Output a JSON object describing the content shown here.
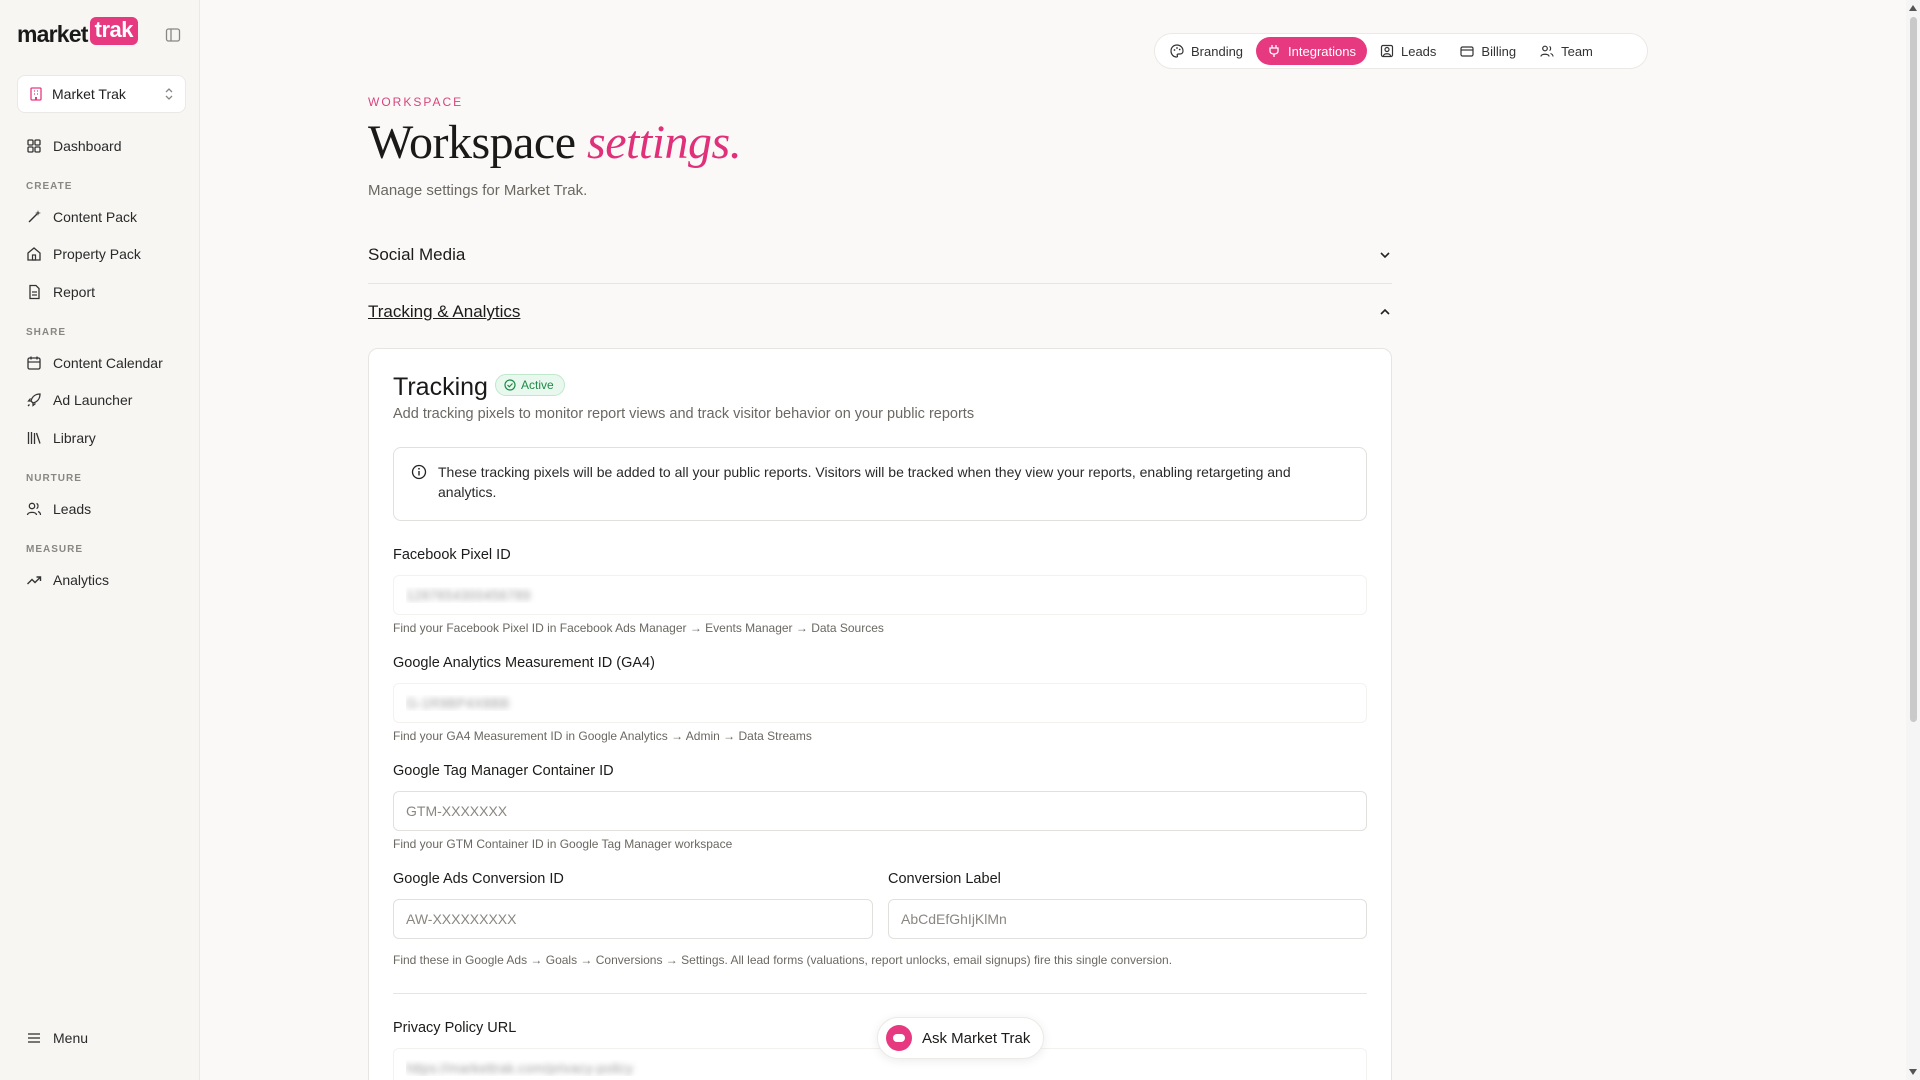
{
  "brand": {
    "logo_part1": "market",
    "logo_part2": "trak",
    "accent_color": "#e6397f"
  },
  "sidebar": {
    "workspace_name": "Market Trak",
    "dashboard": "Dashboard",
    "sections": {
      "create": "CREATE",
      "share": "SHARE",
      "nurture": "NURTURE",
      "measure": "MEASURE"
    },
    "items": {
      "content_pack": "Content Pack",
      "property_pack": "Property Pack",
      "report": "Report",
      "content_calendar": "Content Calendar",
      "ad_launcher": "Ad Launcher",
      "library": "Library",
      "leads": "Leads",
      "analytics": "Analytics"
    },
    "menu": "Menu"
  },
  "top_tabs": {
    "branding": "Branding",
    "integrations": "Integrations",
    "leads": "Leads",
    "billing": "Billing",
    "team": "Team",
    "active": "Integrations"
  },
  "header": {
    "eyebrow": "WORKSPACE",
    "title_main": "Workspace",
    "title_accent": "settings.",
    "subtitle": "Manage settings for Market Trak."
  },
  "accordions": {
    "social_media": "Social Media",
    "tracking_analytics": "Tracking & Analytics"
  },
  "tracking": {
    "title": "Tracking",
    "badge": "Active",
    "description": "Add tracking pixels to monitor report views and track visitor behavior on your public reports",
    "info": "These tracking pixels will be added to all your public reports. Visitors will be tracked when they view your reports, enabling retargeting and analytics.",
    "fields": {
      "facebook": {
        "label": "Facebook Pixel ID",
        "value": "1287654300456789",
        "hint": "Find your Facebook Pixel ID in Facebook Ads Manager → Events Manager → Data Sources"
      },
      "ga4": {
        "label": "Google Analytics Measurement ID (GA4)",
        "value": "G-1R9BP4X8BB",
        "hint": "Find your GA4 Measurement ID in Google Analytics → Admin → Data Streams"
      },
      "gtm": {
        "label": "Google Tag Manager Container ID",
        "placeholder": "GTM-XXXXXXX",
        "hint": "Find your GTM Container ID in Google Tag Manager workspace"
      },
      "ads_conversion": {
        "label": "Google Ads Conversion ID",
        "placeholder": "AW-XXXXXXXXX"
      },
      "conversion_label": {
        "label": "Conversion Label",
        "placeholder": "AbCdEfGhIjKlMn"
      },
      "ads_hint": "Find these in Google Ads → Goals → Conversions → Settings. All lead forms (valuations, report unlocks, email signups) fire this single conversion.",
      "privacy": {
        "label": "Privacy Policy URL",
        "value": "https://markettrak.com/privacy-policy"
      }
    }
  },
  "ask_button": "Ask Market Trak"
}
